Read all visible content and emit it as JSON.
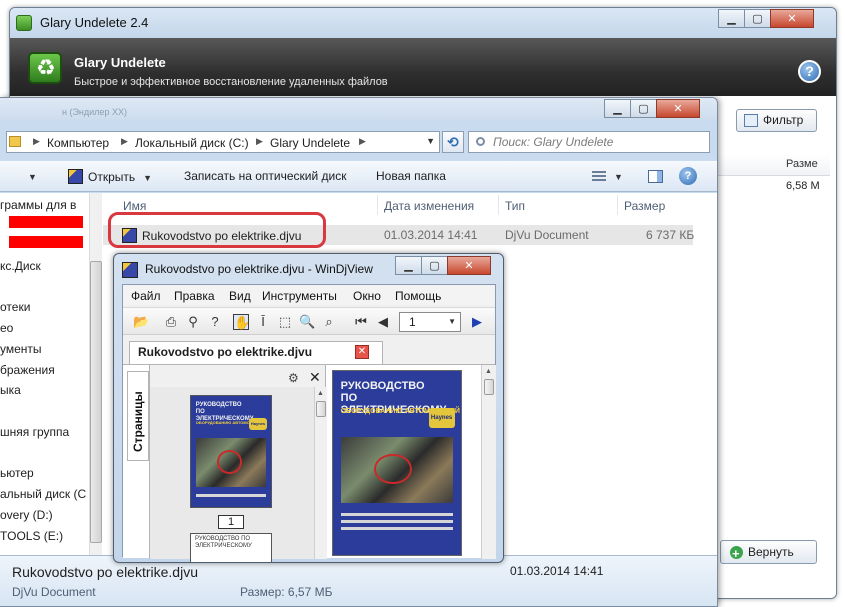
{
  "glary": {
    "title": "Glary Undelete 2.4",
    "app_name": "Glary Undelete",
    "subtitle": "Быстрое и эффективное восстановление удаленных файлов",
    "help": "?",
    "filter_label": "Фильтр",
    "size_col_header": "Разме",
    "size_value": "6,58 М",
    "restore_label": "Вернуть"
  },
  "window_controls": {
    "minimize": "▁",
    "maximize": "▢",
    "close": "✕"
  },
  "explorer": {
    "faded_path": "н (Эндилер ХХ)",
    "breadcrumb": [
      "Компьютер",
      "Локальный диск (C:)",
      "Glary Undelete"
    ],
    "search_placeholder": "Поиск: Glary Undelete",
    "toolbar": {
      "organize_caret": "▼",
      "open": "Открыть",
      "burn": "Записать на оптический диск",
      "new_folder": "Новая папка"
    },
    "nav_items": [
      "граммы для в",
      "кс.Диск",
      "отеки",
      "ео",
      "ументы",
      "бражения",
      "ыка",
      "шняя группа",
      "ьютер",
      "альный диск (С",
      "overy (D:)",
      "TOOLS (E:)"
    ],
    "columns": {
      "name": "Имя",
      "date": "Дата изменения",
      "type": "Тип",
      "size": "Размер"
    },
    "file": {
      "name": "Rukovodstvo po elektrike.djvu",
      "date": "01.03.2014 14:41",
      "type": "DjVu Document",
      "size": "6 737 КБ"
    },
    "details": {
      "name": "Rukovodstvo po elektrike.djvu",
      "type": "DjVu Document",
      "size_label": "Размер:",
      "size_value": "6,57 МБ",
      "date": "01.03.2014 14:41"
    }
  },
  "djview": {
    "title": "Rukovodstvo po elektrike.djvu - WinDjView",
    "menu": [
      "Файл",
      "Правка",
      "Вид",
      "Инструменты",
      "Окно",
      "Помощь"
    ],
    "page_selector": "1",
    "tab_label": "Rukovodstvo po elektrike.djvu",
    "sidebar_tab": "Страницы",
    "thumb_close": "✕",
    "page_number": "1",
    "cover": {
      "title": "РУКОВОДСТВО ПО ЭЛЕКТРИЧЕСКОМУ",
      "subtitle": "ОБОРУДОВАНИЮ АВТОМОБИЛЕЙ",
      "badge": "Haynes"
    },
    "page2_text": "РУКОВОДСТВО ПО ЭЛЕКТРИЧЕСКОМУ"
  }
}
